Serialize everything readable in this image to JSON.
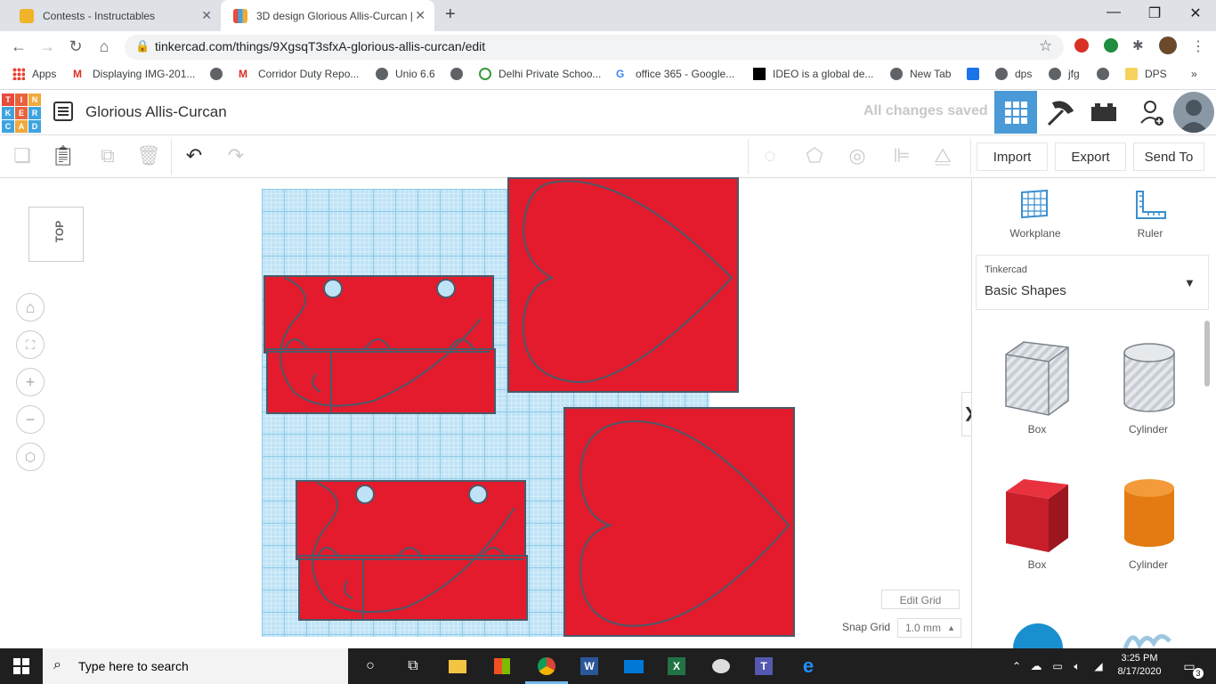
{
  "browser": {
    "tabs": [
      {
        "title": "Contests - Instructables",
        "active": false
      },
      {
        "title": "3D design Glorious Allis-Curcan |",
        "active": true
      }
    ],
    "new_tab_symbol": "+",
    "url": "tinkercad.com/things/9XgsqT3sfxA-glorious-allis-curcan/edit",
    "bookmarks": [
      {
        "label": "Apps",
        "icon": "apps-grid-icon"
      },
      {
        "label": "Displaying IMG-201...",
        "icon": "gmail-icon"
      },
      {
        "label": "",
        "icon": "globe-icon"
      },
      {
        "label": "Corridor Duty Repo...",
        "icon": "gmail-icon"
      },
      {
        "label": "Unio 6.6",
        "icon": "globe-icon"
      },
      {
        "label": "",
        "icon": "globe-icon"
      },
      {
        "label": "Delhi Private Schoo...",
        "icon": "school-icon"
      },
      {
        "label": "office 365 - Google...",
        "icon": "google-icon"
      },
      {
        "label": "IDEO is a global de...",
        "icon": "ideo-icon"
      },
      {
        "label": "New Tab",
        "icon": "globe-icon"
      },
      {
        "label": "",
        "icon": "arrow-icon"
      },
      {
        "label": "dps",
        "icon": "globe-icon"
      },
      {
        "label": "jfg",
        "icon": "globe-icon"
      },
      {
        "label": "",
        "icon": "globe-icon"
      },
      {
        "label": "DPS",
        "icon": "folder-icon"
      }
    ],
    "more_bookmarks": "»"
  },
  "tinkercad": {
    "logo_letters": [
      "T",
      "I",
      "N",
      "K",
      "E",
      "R",
      "C",
      "A",
      "D"
    ],
    "logo_colors": [
      "#e84a3c",
      "#e8633c",
      "#f0a93b",
      "#3da4e0",
      "#e8633c",
      "#3da4e0",
      "#3da4e0",
      "#f0a93b",
      "#3da4e0"
    ],
    "design_title": "Glorious Allis-Curcan",
    "save_status": "All changes saved",
    "import_label": "Import",
    "export_label": "Export",
    "send_to_label": "Send To",
    "view_cube_label": "TOP",
    "edit_grid_label": "Edit Grid",
    "snap_grid_label": "Snap Grid",
    "snap_grid_value": "1.0 mm",
    "workplane_label": "Workplane",
    "ruler_label": "Ruler",
    "library_source": "Tinkercad",
    "library_name": "Basic Shapes",
    "shapes": [
      {
        "label": "Box",
        "style": "hole"
      },
      {
        "label": "Cylinder",
        "style": "hole"
      },
      {
        "label": "Box",
        "style": "solid",
        "color": "#d0202c"
      },
      {
        "label": "Cylinder",
        "style": "solid",
        "color": "#e8821e"
      }
    ],
    "accent_color": "#4b9ad8",
    "object_color": "#e31b2c"
  },
  "taskbar": {
    "search_placeholder": "Type here to search",
    "time": "3:25 PM",
    "date": "8/17/2020",
    "notifications": "3"
  }
}
